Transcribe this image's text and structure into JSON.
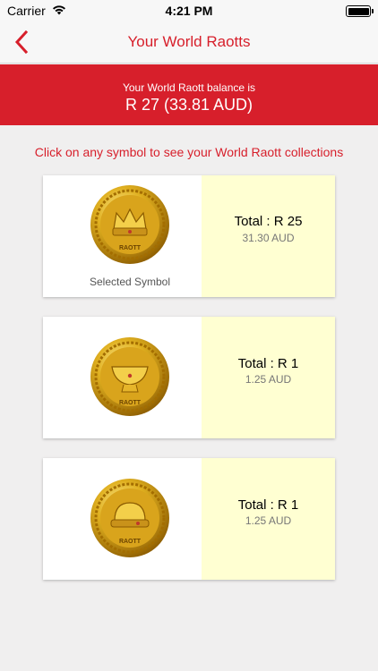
{
  "status_bar": {
    "carrier": "Carrier",
    "time": "4:21 PM"
  },
  "nav": {
    "title": "Your World Raotts",
    "back_icon": "chevron-left-icon"
  },
  "balance": {
    "label": "Your World Raott balance is",
    "value": "R 27 (33.81 AUD)"
  },
  "instruction": "Click on any symbol to see your World Raott collections",
  "colors": {
    "accent": "#d71f2b",
    "card_highlight": "#ffffd2",
    "background": "#f0efef"
  },
  "symbols": [
    {
      "icon": "crown-coin-icon",
      "selected_label": "Selected Symbol",
      "total": "Total : R 25",
      "aud": "31.30 AUD"
    },
    {
      "icon": "bowl-coin-icon",
      "selected_label": "",
      "total": "Total : R 1",
      "aud": "1.25 AUD"
    },
    {
      "icon": "helmet-coin-icon",
      "selected_label": "",
      "total": "Total : R 1",
      "aud": "1.25 AUD"
    }
  ]
}
